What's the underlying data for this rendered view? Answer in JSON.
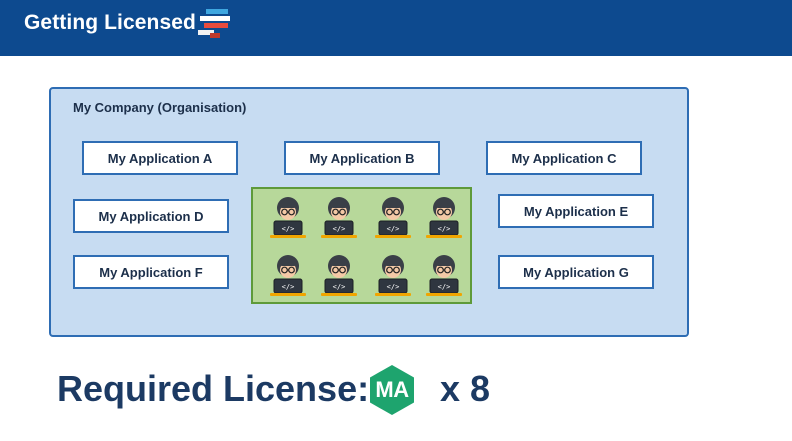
{
  "header": {
    "title": "Getting Licensed",
    "logo_icon": "stacked-bars-logo-icon",
    "background": "#0d4a8f"
  },
  "organisation": {
    "label": "My Company (Organisation)",
    "applications": [
      {
        "label": "My Application A"
      },
      {
        "label": "My Application B"
      },
      {
        "label": "My Application C"
      },
      {
        "label": "My Application D"
      },
      {
        "label": "My Application E"
      },
      {
        "label": "My Application F"
      },
      {
        "label": "My Application G"
      }
    ],
    "developers": {
      "count": 8,
      "icon": "developer-laptop-icon"
    }
  },
  "license": {
    "label": "Required License:",
    "badge_text": "MA",
    "badge_color": "#1ea46e",
    "multiplier": "x 8"
  }
}
